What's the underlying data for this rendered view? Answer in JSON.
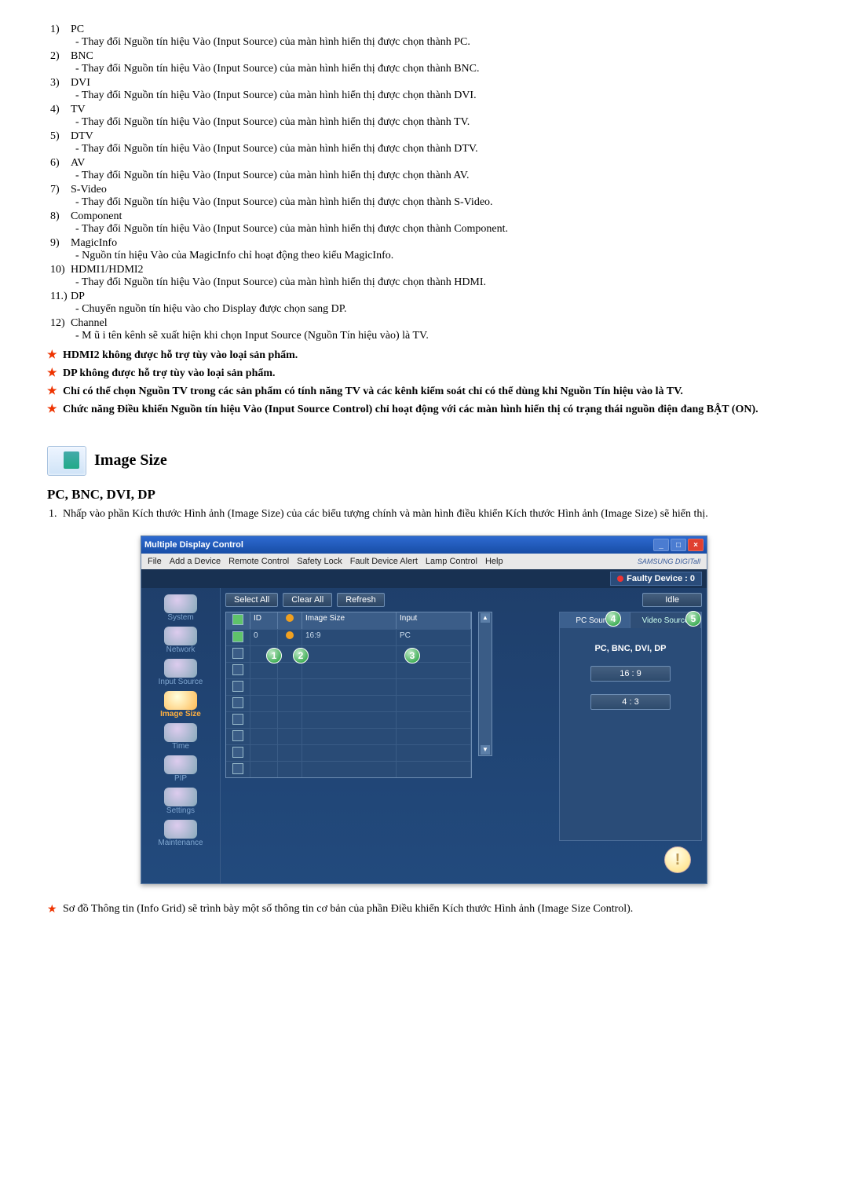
{
  "list": [
    {
      "num": "1)",
      "term": "PC",
      "desc": "- Thay đổi Nguồn tín hiệu Vào (Input Source) của màn hình hiển thị được chọn thành PC."
    },
    {
      "num": "2)",
      "term": "BNC",
      "desc": "- Thay đổi Nguồn tín hiệu Vào (Input Source) của màn hình hiển thị được chọn thành BNC."
    },
    {
      "num": "3)",
      "term": "DVI",
      "desc": "- Thay đổi Nguồn tín hiệu Vào (Input Source) của màn hình hiển thị được chọn thành DVI."
    },
    {
      "num": "4)",
      "term": "TV",
      "desc": "- Thay đổi Nguồn tín hiệu Vào (Input Source) của màn hình hiển thị được chọn thành TV."
    },
    {
      "num": "5)",
      "term": "DTV",
      "desc": "- Thay đổi Nguồn tín hiệu Vào (Input Source) của màn hình hiển thị được chọn thành DTV."
    },
    {
      "num": "6)",
      "term": "AV",
      "desc": "- Thay đổi Nguồn tín hiệu Vào (Input Source) của màn hình hiển thị được chọn thành AV."
    },
    {
      "num": "7)",
      "term": "S-Video",
      "desc": "- Thay đổi Nguồn tín hiệu Vào (Input Source) của màn hình hiển thị được chọn thành S-Video."
    },
    {
      "num": "8)",
      "term": "Component",
      "desc": "- Thay đổi Nguồn tín hiệu Vào (Input Source) của màn hình hiển thị được chọn thành Component."
    },
    {
      "num": "9)",
      "term": "MagicInfo",
      "desc": "- Nguồn tín hiệu Vào của MagicInfo chỉ hoạt động theo kiểu MagicInfo."
    },
    {
      "num": "10)",
      "term": "HDMI1/HDMI2",
      "desc": "- Thay đổi Nguồn tín hiệu Vào (Input Source) của màn hình hiển thị được chọn thành HDMI."
    },
    {
      "num": "11.)",
      "term": "DP",
      "desc": "- Chuyển nguồn tín hiệu vào cho Display được chọn sang DP."
    },
    {
      "num": "12)",
      "term": "Channel",
      "desc": "- M ũ i tên kênh sẽ xuất hiện khi chọn Input Source (Nguồn Tín hiệu vào) là TV."
    }
  ],
  "notes": [
    "HDMI2 không được hỗ trợ tùy vào loại sản phẩm.",
    "DP không được hỗ trợ tùy vào loại sản phẩm.",
    "Chỉ có thể chọn Nguồn TV trong các sản phẩm có tính năng TV và các kênh kiểm soát chỉ có thể dùng khi Nguồn Tín hiệu vào là TV.",
    "Chức năng Điều khiển Nguồn tín hiệu Vào (Input Source Control) chỉ hoạt động với các màn hình hiển thị có trạng thái nguồn điện đang BẬT (ON)."
  ],
  "section": {
    "title": "Image Size",
    "sub": "PC, BNC, DVI, DP",
    "step": "Nhấp vào phần Kích thước Hình ảnh (Image Size) của các biểu tượng chính và màn hình điều khiển Kích thước Hình ảnh (Image Size) sẽ hiển thị."
  },
  "shot": {
    "title": "Multiple Display Control",
    "menu": [
      "File",
      "Add a Device",
      "Remote Control",
      "Safety Lock",
      "Fault Device Alert",
      "Lamp Control",
      "Help"
    ],
    "logo": "SAMSUNG DIGITall",
    "faulty": "Faulty Device : 0",
    "buttons": {
      "selectall": "Select All",
      "clearall": "Clear All",
      "refresh": "Refresh",
      "idle": "Idle"
    },
    "nav": [
      "System",
      "Network",
      "Input Source",
      "Image Size",
      "Time",
      "PIP",
      "Settings",
      "Maintenance"
    ],
    "cols": {
      "id": "ID",
      "isize": "Image Size",
      "input": "Input"
    },
    "row": {
      "id": "0",
      "isize": "16:9",
      "input": "PC"
    },
    "right": {
      "pcsource": "PC Source",
      "videosource": "Video Source",
      "label": "PC, BNC, DVI, DP",
      "o1": "16 : 9",
      "o2": "4 : 3"
    }
  },
  "footnote": "Sơ đồ Thông tin (Info Grid) sẽ trình bày một số thông tin cơ bản của phần Điều khiển Kích thước Hình ảnh (Image Size Control)."
}
